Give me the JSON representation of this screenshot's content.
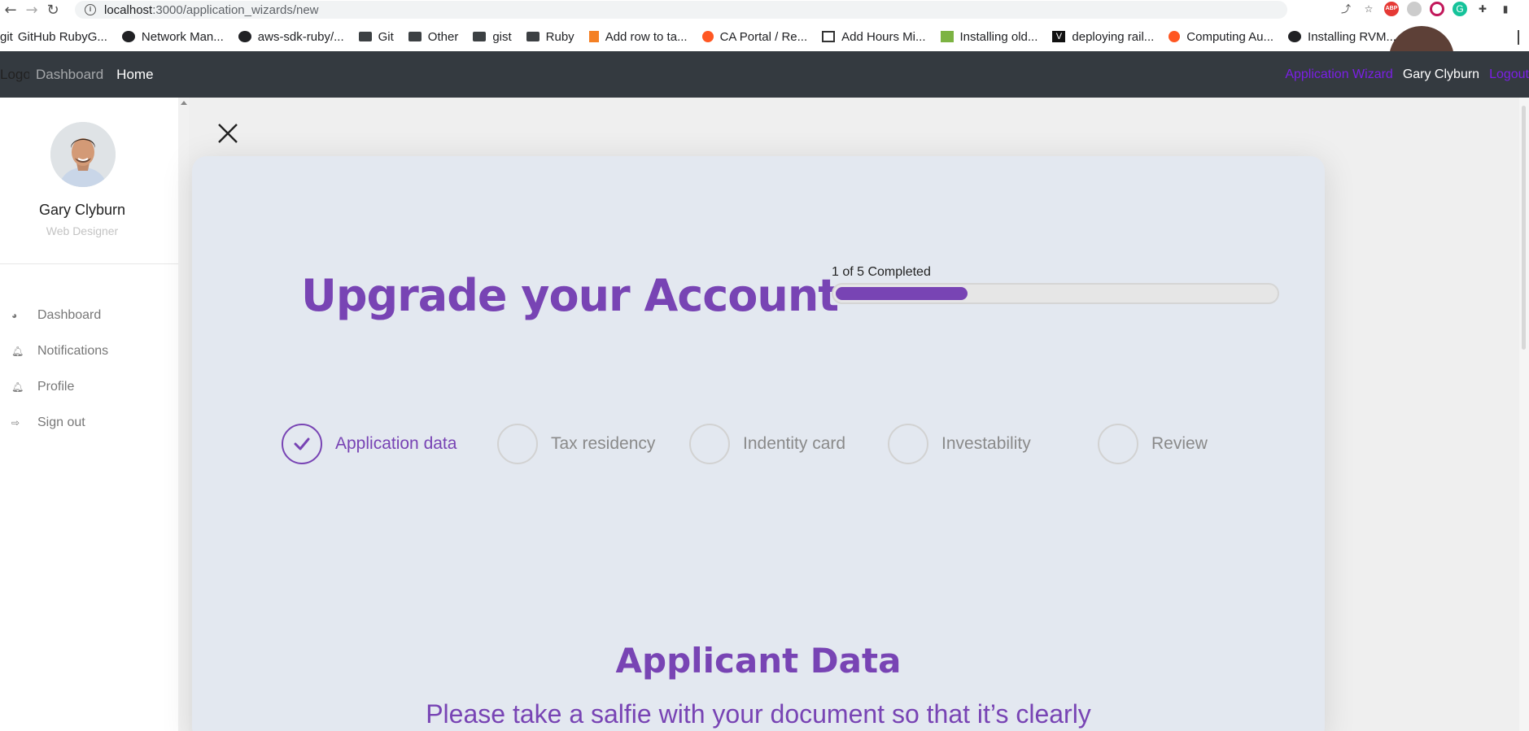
{
  "browser": {
    "url_host": "localhost",
    "url_path": ":3000/application_wizards/new",
    "bookmarks": [
      {
        "label": "GitHub RubyG...",
        "icon": "git-icon"
      },
      {
        "label": "Network Man...",
        "icon": "github-icon"
      },
      {
        "label": "aws-sdk-ruby/...",
        "icon": "github-icon"
      },
      {
        "label": "Git",
        "icon": "folder-icon"
      },
      {
        "label": "Other",
        "icon": "folder-icon"
      },
      {
        "label": "gist",
        "icon": "folder-icon"
      },
      {
        "label": "Ruby",
        "icon": "folder-icon"
      },
      {
        "label": "Add row to ta...",
        "icon": "stackoverflow-icon"
      },
      {
        "label": "CA Portal / Re...",
        "icon": "ca-icon"
      },
      {
        "label": "Add Hours Mi...",
        "icon": "calendar-icon"
      },
      {
        "label": "Installing old...",
        "icon": "green-icon"
      },
      {
        "label": "deploying rail...",
        "icon": "v-icon"
      },
      {
        "label": "Computing Au...",
        "icon": "ca-icon"
      },
      {
        "label": "Installing RVM...",
        "icon": "github-icon"
      }
    ],
    "bookmark_prefix": "git"
  },
  "navbar": {
    "logo": "Logo",
    "dashboard": "Dashboard",
    "home": "Home",
    "wizard": "Application Wizard",
    "user": "Gary Clyburn",
    "logout": "Logout"
  },
  "sidebar": {
    "name": "Gary Clyburn",
    "role": "Web Designer",
    "items": [
      {
        "label": "Dashboard",
        "icon": "pie-chart-icon"
      },
      {
        "label": "Notifications",
        "icon": "bell-icon"
      },
      {
        "label": "Profile",
        "icon": "bell-icon"
      },
      {
        "label": "Sign out",
        "icon": "sign-out-icon"
      }
    ]
  },
  "wizard": {
    "title": "Upgrade your Account",
    "progress_label": "1 of 5 Completed",
    "progress_fraction": 0.3,
    "accent_color": "#7844b4",
    "steps": [
      {
        "label": "Application data",
        "done": true
      },
      {
        "label": "Tax residency",
        "done": false
      },
      {
        "label": "Indentity card",
        "done": false
      },
      {
        "label": "Investability",
        "done": false
      },
      {
        "label": "Review",
        "done": false
      }
    ],
    "section_title": "Applicant Data",
    "section_subtitle": "Please take a salfie with your document so that it’s clearly"
  }
}
